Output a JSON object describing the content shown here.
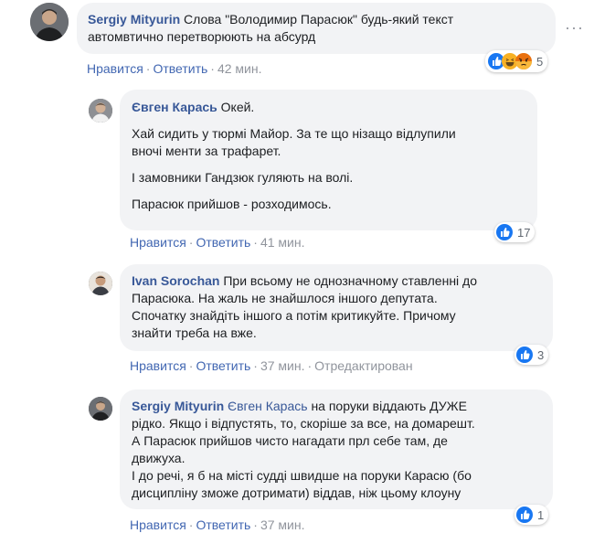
{
  "comments": [
    {
      "author": "Sergiy Mityurin",
      "lines": [
        "Слова \"Володимир Парасюк\" будь-який текст",
        "автомвтично перетворюють на абсурд"
      ],
      "like": "Нравится",
      "reply": "Ответить",
      "time": "42 мин.",
      "reaction_count": "5"
    },
    {
      "author": "Євген Карась",
      "first_line": "Окей.",
      "paragraphs": [
        [
          "Хай сидить у тюрмі Майор. За те що нізащо відлупили",
          "вночі менти за трафарет."
        ],
        [
          "І замовники Гандзюк гуляють на волі."
        ],
        [
          "Парасюк прийшов - розходимось."
        ]
      ],
      "like": "Нравится",
      "reply": "Ответить",
      "time": "41 мин.",
      "reaction_count": "17"
    },
    {
      "author": "Ivan Sorochan",
      "first_line": "При всьому не однозначному ставленні до",
      "lines": [
        "Парасюка. На жаль не знайшлося іншого депутата.",
        "Спочатку знайдіть іншого а потім критикуйте. Причому",
        "знайти треба на вже."
      ],
      "like": "Нравится",
      "reply": "Ответить",
      "time": "37 мин.",
      "edited": "Отредактирован",
      "reaction_count": "3"
    },
    {
      "author": "Sergiy Mityurin",
      "mention": "Євген Карась",
      "first_line": "на поруки віддають ДУЖЕ",
      "lines": [
        "рідко. Якщо і відпустять, то, скоріше за все, на домарешт.",
        "А Парасюк прийшов чисто нагадати прл себе там, де",
        "движуха.",
        "І до речі, я б на місті судді швидше на поруки Карасю (бо",
        "дисципліну зможе дотримати) віддав, ніж цьому клоуну"
      ],
      "like": "Нравится",
      "reply": "Ответить",
      "time": "37 мин.",
      "reaction_count": "1"
    }
  ],
  "icons": {
    "more": "more-options-icon",
    "like": "like-reaction-icon",
    "haha": "haha-reaction-icon",
    "angry": "angry-reaction-icon"
  },
  "colors": {
    "link": "#385898",
    "action": "#4267b2",
    "muted": "#90949c",
    "bubble": "#f2f3f5",
    "like_blue": "#1877f2"
  }
}
